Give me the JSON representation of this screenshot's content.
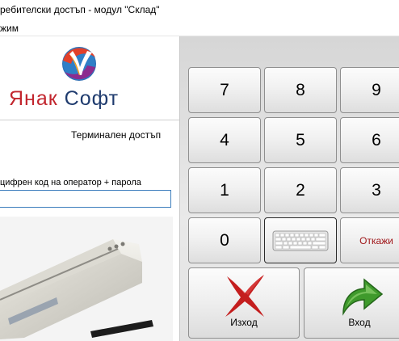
{
  "window": {
    "title": "ребителски достъп - модул \"Склад\""
  },
  "menu": {
    "item": "жим"
  },
  "brand": {
    "name_part1": "Янак",
    "name_part2": "Софт"
  },
  "panel": {
    "terminal_label": "Терминален достъп",
    "prompt": "цифрен код на оператор + парола",
    "input_value": "",
    "input_placeholder": ""
  },
  "keypad": {
    "keys": [
      "7",
      "8",
      "9",
      "4",
      "5",
      "6",
      "1",
      "2",
      "3",
      "0"
    ],
    "cancel_label": "Откажи",
    "exit_label": "Изход",
    "enter_label": "Вход"
  },
  "colors": {
    "accent_red": "#c2262e",
    "brand_blue": "#1f3b6e",
    "enter_green": "#3f9a2c"
  }
}
